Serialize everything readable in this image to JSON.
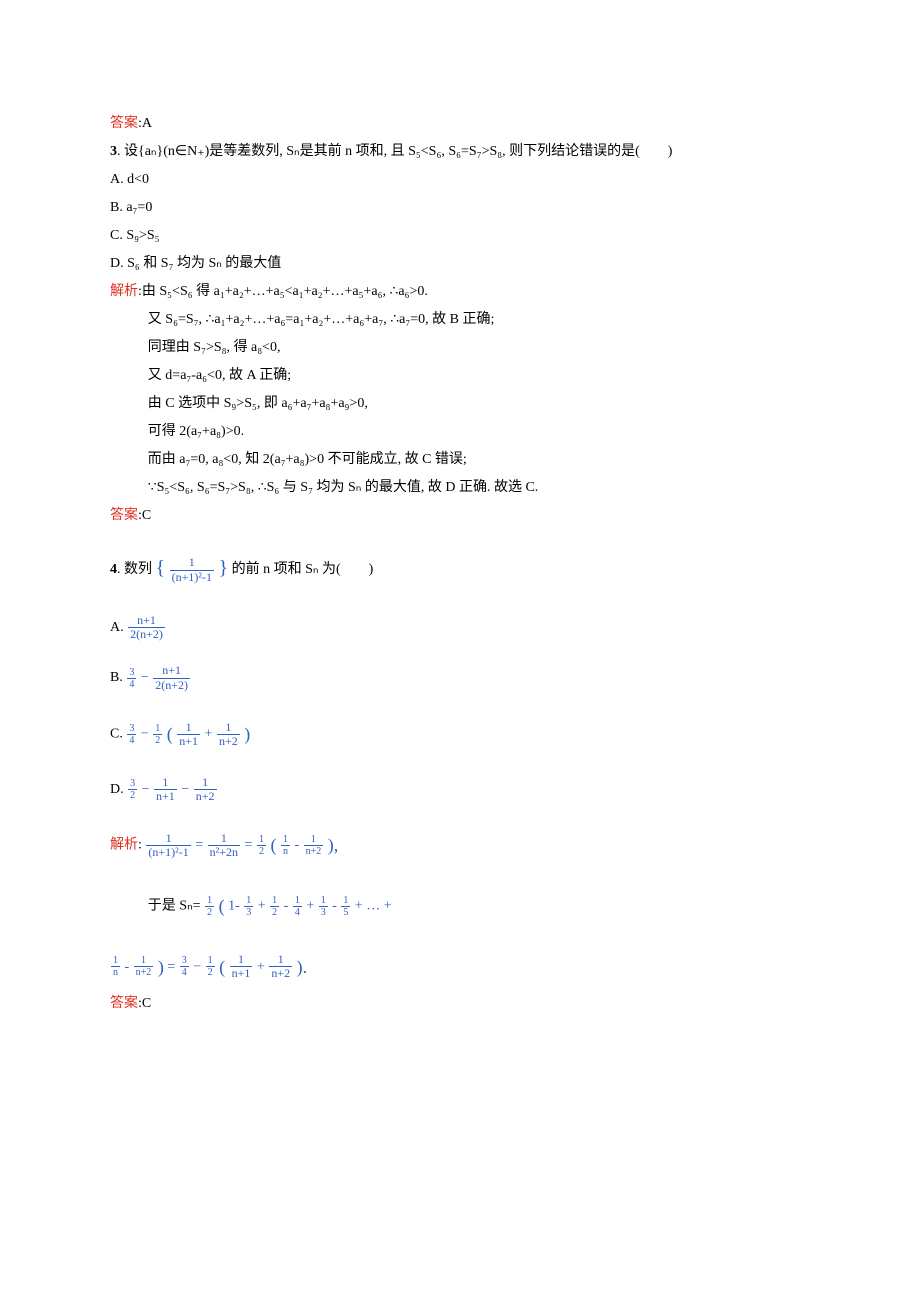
{
  "ans2": {
    "label": "答案",
    "val": ":A"
  },
  "q3": {
    "num": "3",
    "stem": ". 设{aₙ}(n∈N₊)是等差数列, Sₙ是其前 n 项和, 且 S₅<S₆, S₆=S₇>S₈, 则下列结论错误的是(　　)",
    "optA": "A. d<0",
    "optB": "B. a₇=0",
    "optC": "C. S₉>S₅",
    "optD": "D. S₆ 和 S₇ 均为 Sₙ 的最大值",
    "sol_label": "解析",
    "sol1": ":由 S₅<S₆ 得 a₁+a₂+…+a₅<a₁+a₂+…+a₅+a₆, ∴a₆>0.",
    "sol2": "又 S₆=S₇, ∴a₁+a₂+…+a₆=a₁+a₂+…+a₆+a₇, ∴a₇=0, 故 B 正确;",
    "sol3": "同理由 S₇>S₈, 得 a₈<0,",
    "sol4": "又 d=a₇-a₆<0, 故 A 正确;",
    "sol5": "由 C 选项中 S₉>S₅, 即 a₆+a₇+a₈+a₉>0,",
    "sol6": "可得 2(a₇+a₈)>0.",
    "sol7": "而由 a₇=0, a₈<0, 知 2(a₇+a₈)>0 不可能成立, 故 C 错误;",
    "sol8": "∵S₅<S₆, S₆=S₇>S₈, ∴S₆ 与 S₇ 均为 Sₙ 的最大值, 故 D 正确. 故选 C.",
    "ans_label": "答案",
    "ans": ":C"
  },
  "q4": {
    "num": "4",
    "pre": ". 数列",
    "post": "的前 n 项和 Sₙ 为(　　)",
    "f_top": "1",
    "f_bot": "(n+1)²-1",
    "A_label": "A.",
    "A_num": "n+1",
    "A_den": "2(n+2)",
    "B_label": "B.",
    "B_34n": "3",
    "B_34d": "4",
    "B_minus": " −",
    "B_num": "n+1",
    "B_den": "2(n+2)",
    "C_label": "C.",
    "C_34n": "3",
    "C_34d": "4",
    "C_m1": " −",
    "C_12n": "1",
    "C_12d": "2",
    "C_lp": "(",
    "C_f1n": "1",
    "C_f1d": "n+1",
    "C_plus": " +",
    "C_f2n": "1",
    "C_f2d": "n+2",
    "C_rp": ")",
    "D_label": "D.",
    "D_32n": "3",
    "D_32d": "2",
    "D_m1": " −",
    "D_f1n": "1",
    "D_f1d": "n+1",
    "D_m2": " −",
    "D_f2n": "1",
    "D_f2d": "n+2",
    "sol_label": "解析",
    "sol_colon": ":",
    "s_f1n": "1",
    "s_f1d": "(n+1)²-1",
    "s_eq1": " =",
    "s_f2n": "1",
    "s_f2d": "n²+2n",
    "s_eq2": " =",
    "s_12n": "1",
    "s_12d": "2",
    "s_lp": "(",
    "s_f3n": "1",
    "s_f3d": "n",
    "s_m1": " -",
    "s_f4n": "1",
    "s_f4d": "n+2",
    "s_rp": "),",
    "line2_pre": "于是 Sₙ=",
    "l2_12n": "1",
    "l2_12d": "2",
    "l2_lp": "(",
    "l2_t1": "1-",
    "l2_13n": "1",
    "l2_13d": "3",
    "l2_p1": " +",
    "l2_12n2": "1",
    "l2_12d2": "2",
    "l2_m1": " -",
    "l2_14n": "1",
    "l2_14d": "4",
    "l2_p2": " +",
    "l2_13n2": "1",
    "l2_13d2": "3",
    "l2_m2": " -",
    "l2_15n": "1",
    "l2_15d": "5",
    "l2_dots": " + … +",
    "line3_f1n": "1",
    "line3_f1d": "n",
    "line3_m1": " -",
    "line3_f2n": "1",
    "line3_f2d": "n+2",
    "line3_rp": ")",
    "line3_eq": " =",
    "line3_34n": "3",
    "line3_34d": "4",
    "line3_m2": " −",
    "line3_12n": "1",
    "line3_12d": "2",
    "line3_lp": "(",
    "line3_g1n": "1",
    "line3_g1d": "n+1",
    "line3_p": " +",
    "line3_g2n": "1",
    "line3_g2d": "n+2",
    "line3_rp2": ").",
    "ans_label": "答案",
    "ans": ":C"
  }
}
